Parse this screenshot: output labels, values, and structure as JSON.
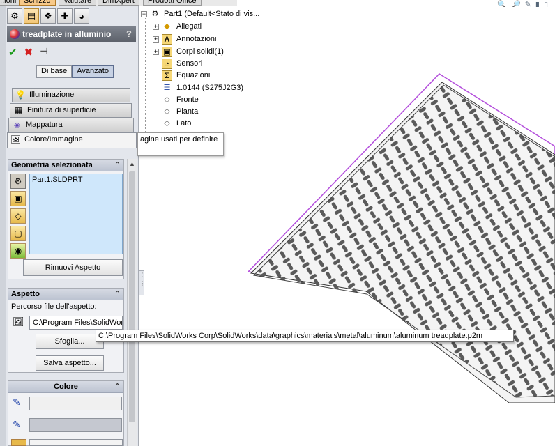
{
  "top_tabs": [
    "...ioni",
    "Schizzo",
    "Valutare",
    "DimXpert",
    "Prodotti Office"
  ],
  "pm": {
    "title": "treadplate in alluminio",
    "help": "?",
    "mode_basic": "Di base",
    "mode_advanced": "Avanzato",
    "tabs": [
      "Illuminazione",
      "Finitura di superficie",
      "Mappatura",
      "Colore/Immagine"
    ],
    "geometry": {
      "header": "Geometria selezionata",
      "items": [
        "Part1.SLDPRT"
      ],
      "remove_button": "Rimuovi Aspetto"
    },
    "appearance": {
      "header": "Aspetto",
      "path_label": "Percorso file dell'aspetto:",
      "path_value": "C:\\Program Files\\SolidWorks",
      "browse_button": "Sfoglia...",
      "save_button": "Salva aspetto..."
    },
    "color": {
      "header": "Colore"
    }
  },
  "tree": {
    "root": "Part1  (Default<Stato di vis...",
    "items": [
      "Allegati",
      "Annotazioni",
      "Corpi solidi(1)",
      "Sensori",
      "Equazioni",
      "1.0144 (S275J2G3)",
      "Fronte",
      "Pianta",
      "Lato"
    ]
  },
  "tooltip_partial": "agine usati per definire",
  "tooltip_path": "C:\\Program Files\\SolidWorks Corp\\SolidWorks\\data\\graphics\\materials\\metal\\aluminum\\aluminum treadplate.p2m",
  "colors": {
    "plate_outline": "#b44fdc",
    "pattern": "#5a5a5a"
  }
}
